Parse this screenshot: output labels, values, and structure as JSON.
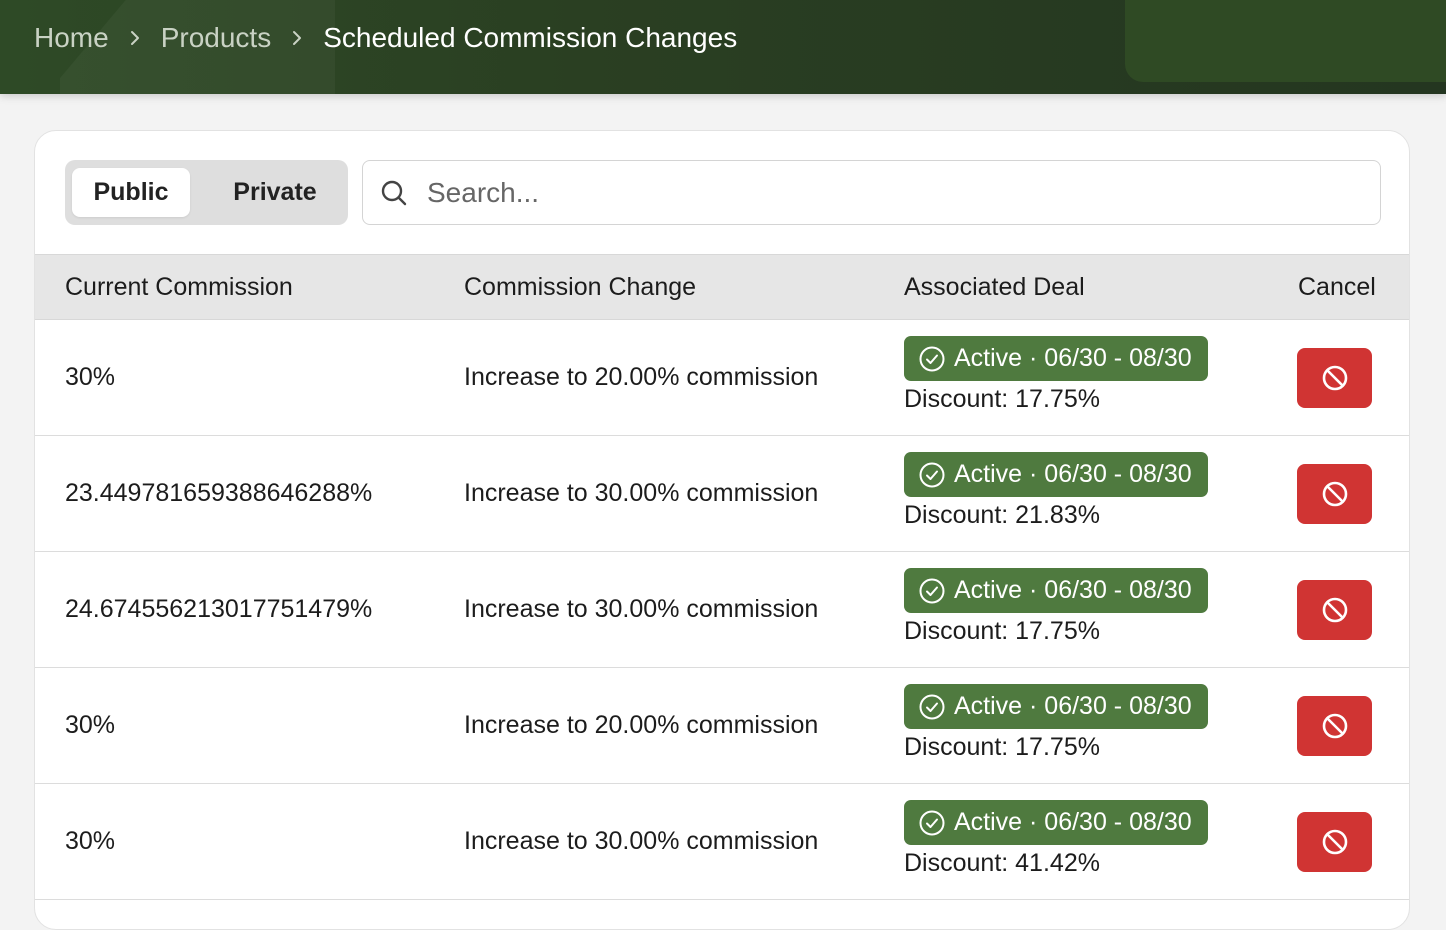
{
  "breadcrumb": {
    "home": "Home",
    "products": "Products",
    "current": "Scheduled Commission Changes"
  },
  "toggle": {
    "public": "Public",
    "private": "Private",
    "selected": "Public"
  },
  "search": {
    "placeholder": "Search...",
    "value": ""
  },
  "table": {
    "headers": [
      "Current Commission",
      "Commission Change",
      "Associated Deal",
      "Cancel"
    ],
    "rows": [
      {
        "current": "30%",
        "change": "Increase to 20.00% commission",
        "deal": "Active · 06/30 - 08/30",
        "discount": "Discount: 17.75%"
      },
      {
        "current": "23.449781659388646288%",
        "change": "Increase to 30.00% commission",
        "deal": "Active · 06/30 - 08/30",
        "discount": "Discount: 21.83%"
      },
      {
        "current": "24.674556213017751479%",
        "change": "Increase to 30.00% commission",
        "deal": "Active · 06/30 - 08/30",
        "discount": "Discount: 17.75%"
      },
      {
        "current": "30%",
        "change": "Increase to 20.00% commission",
        "deal": "Active · 06/30 - 08/30",
        "discount": "Discount: 17.75%"
      },
      {
        "current": "30%",
        "change": "Increase to 30.00% commission",
        "deal": "Active · 06/30 - 08/30",
        "discount": "Discount: 41.42%"
      }
    ]
  },
  "icons": {
    "breadcrumb_separator": "chevron-right-icon",
    "search": "search-icon",
    "deal_status": "check-circle-icon",
    "cancel": "ban-icon"
  },
  "colors": {
    "header_bg": "#2a3f22",
    "badge_active": "#4f7a3f",
    "cancel_button": "#d03433"
  }
}
